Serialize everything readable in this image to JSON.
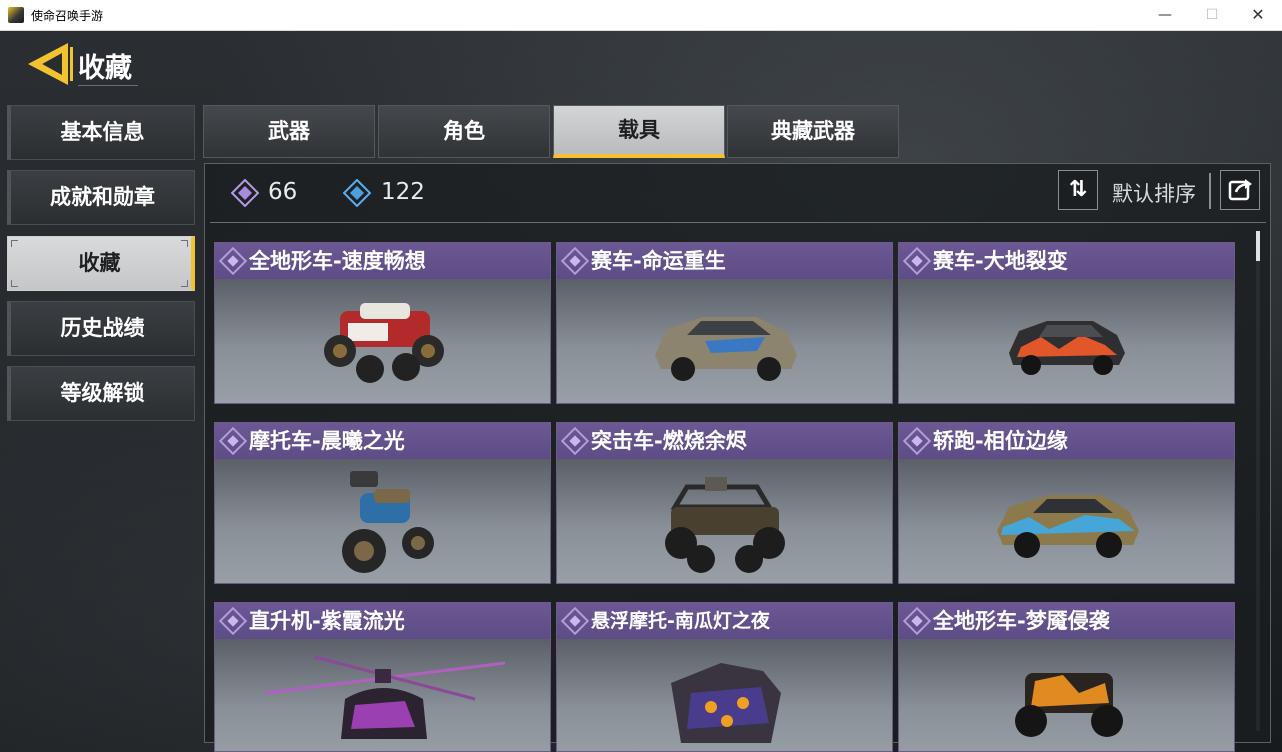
{
  "window": {
    "title": "使命召唤手游",
    "minimize_glyph": "—",
    "maximize_glyph": "☐",
    "close_glyph": "✕"
  },
  "header": {
    "title": "收藏"
  },
  "sidebar": {
    "items": [
      {
        "label": "基本信息",
        "active": false
      },
      {
        "label": "成就和勋章",
        "active": false
      },
      {
        "label": "收藏",
        "active": true
      },
      {
        "label": "历史战绩",
        "active": false
      },
      {
        "label": "等级解锁",
        "active": false
      }
    ]
  },
  "tabs": [
    {
      "label": "武器",
      "active": false
    },
    {
      "label": "角色",
      "active": false
    },
    {
      "label": "载具",
      "active": true
    },
    {
      "label": "典藏武器",
      "active": false
    }
  ],
  "stats": {
    "purple_count": "66",
    "blue_count": "122"
  },
  "sort": {
    "label": "默认排序",
    "icon": "sort-arrows-icon"
  },
  "cards": [
    {
      "title": "全地形车-速度畅想",
      "vehicle": "atv"
    },
    {
      "title": "赛车-命运重生",
      "vehicle": "car"
    },
    {
      "title": "赛车-大地裂变",
      "vehicle": "car"
    },
    {
      "title": "摩托车-晨曦之光",
      "vehicle": "motorcycle"
    },
    {
      "title": "突击车-燃烧余烬",
      "vehicle": "buggy"
    },
    {
      "title": "轿跑-相位边缘",
      "vehicle": "car"
    },
    {
      "title": "直升机-紫霞流光",
      "vehicle": "helicopter"
    },
    {
      "title": "悬浮摩托-南瓜灯之夜",
      "vehicle": "hoverbike"
    },
    {
      "title": "全地形车-梦魇侵袭",
      "vehicle": "atv"
    }
  ],
  "colors": {
    "accent": "#f2c230",
    "epic_purple": "#6b5894",
    "rare_blue": "#4aa0e0"
  }
}
